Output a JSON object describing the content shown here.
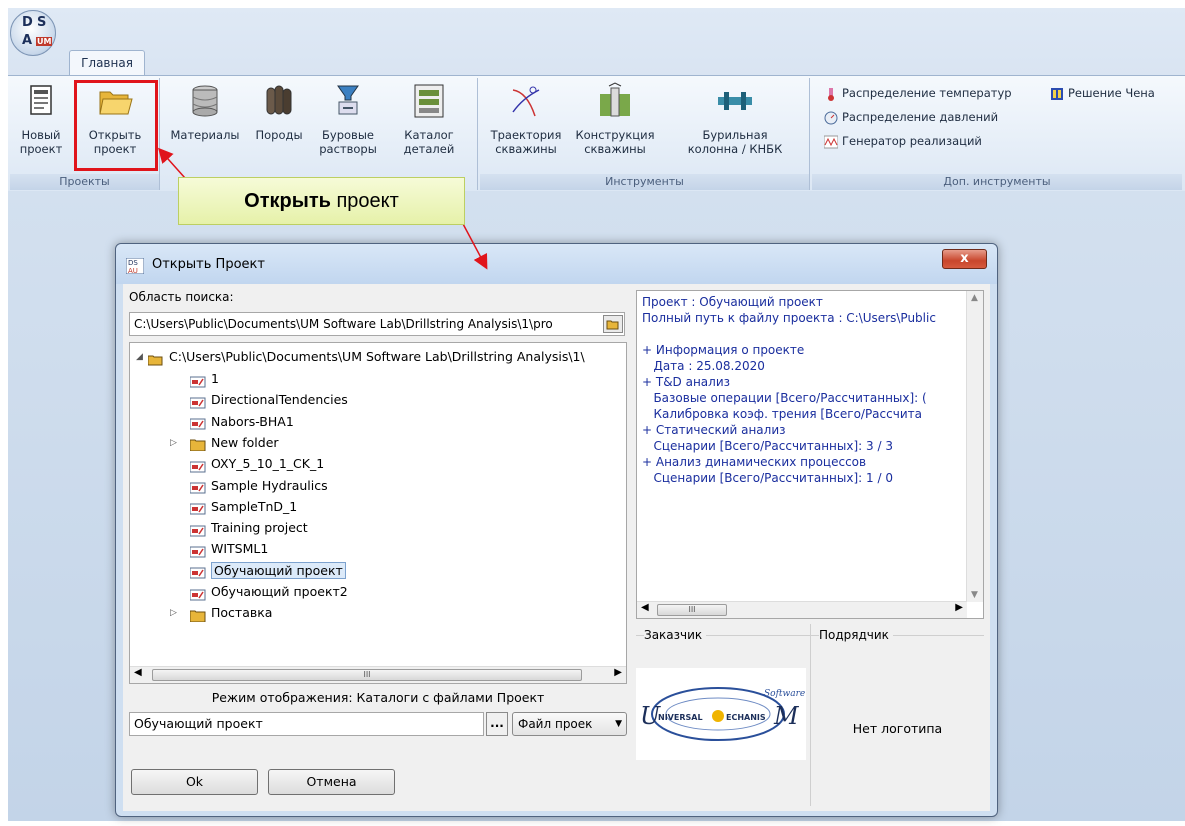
{
  "app": {
    "logo_letters": [
      "D",
      "S",
      "A",
      "UM"
    ]
  },
  "ribbon": {
    "tab_home": "Главная",
    "groups": {
      "projects": "Проекты",
      "tools": "Инструменты",
      "extra_tools": "Доп. инструменты"
    },
    "buttons": {
      "new_project": [
        "Новый",
        "проект"
      ],
      "open_project": [
        "Открыть",
        "проект"
      ],
      "materials": [
        "Материалы",
        ""
      ],
      "rocks": [
        "Породы",
        ""
      ],
      "drilling_fluids": [
        "Буровые",
        "растворы"
      ],
      "parts_catalog": [
        "Каталог",
        "деталей"
      ],
      "well_trajectory": [
        "Траектория",
        "скважины"
      ],
      "well_construction": [
        "Конструкция",
        "скважины"
      ],
      "drill_string": [
        "Бурильная",
        "колонна / КНБК"
      ]
    },
    "small_buttons": {
      "temp_distribution": "Распределение температур",
      "chen_solution": "Решение Чена",
      "pressure_distribution": "Распределение давлений",
      "realization_generator": "Генератор реализаций"
    }
  },
  "callout": {
    "bold": "Открыть",
    "rest": " проект"
  },
  "dialog": {
    "title": "Открыть Проект",
    "close_label": "x",
    "search_area_label": "Область поиска:",
    "search_path": "C:\\Users\\Public\\Documents\\UM Software Lab\\Drillstring Analysis\\1\\pro",
    "tree": {
      "root": "C:\\Users\\Public\\Documents\\UM Software Lab\\Drillstring Analysis\\1\\",
      "items": [
        {
          "label": "1",
          "type": "project"
        },
        {
          "label": "DirectionalTendencies",
          "type": "project"
        },
        {
          "label": "Nabors-BHA1",
          "type": "project"
        },
        {
          "label": "New folder",
          "type": "folder"
        },
        {
          "label": "OXY_5_10_1_CK_1",
          "type": "project"
        },
        {
          "label": "Sample Hydraulics",
          "type": "project"
        },
        {
          "label": "SampleTnD_1",
          "type": "project"
        },
        {
          "label": "Training project",
          "type": "project"
        },
        {
          "label": "WITSML1",
          "type": "project"
        },
        {
          "label": "Обучающий проект",
          "type": "project",
          "selected": true
        },
        {
          "label": "Обучающий проект2",
          "type": "project"
        },
        {
          "label": "Поставка",
          "type": "folder"
        }
      ]
    },
    "scroll_grip": "III",
    "display_mode": "Режим отображения: Каталоги с файлами Проект",
    "file_name": "Обучающий проект",
    "ellipsis": "...",
    "file_type": "Файл проек",
    "ok_label": "Ok",
    "cancel_label": "Отмена",
    "info": [
      "Проект : Обучающий проект",
      "Полный путь к файлу проекта : C:\\Users\\Public",
      "",
      "+ Информация о проекте",
      "   Дата : 25.08.2020",
      "+ T&D анализ",
      "   Базовые операции [Всего/Рассчитанных]: (",
      "   Калибровка коэф. трения [Всего/Рассчита",
      "+ Статический анализ",
      "   Сценарии [Всего/Рассчитанных]: 3 / 3",
      "+ Анализ динамических процессов",
      "   Сценарии [Всего/Рассчитанных]: 1 / 0"
    ],
    "customer_label": "Заказчик",
    "contractor_label": "Подрядчик",
    "customer_logo_text": {
      "software": "Software",
      "brand_left": "NIVERSAL",
      "brand_right": "ECHANIS",
      "u": "U",
      "m": "M"
    },
    "no_logo": "Нет логотипа"
  },
  "colors": {
    "highlight": "#e0141b",
    "info_text": "#1a2e9e",
    "callout_bg": "#eef6c0"
  }
}
